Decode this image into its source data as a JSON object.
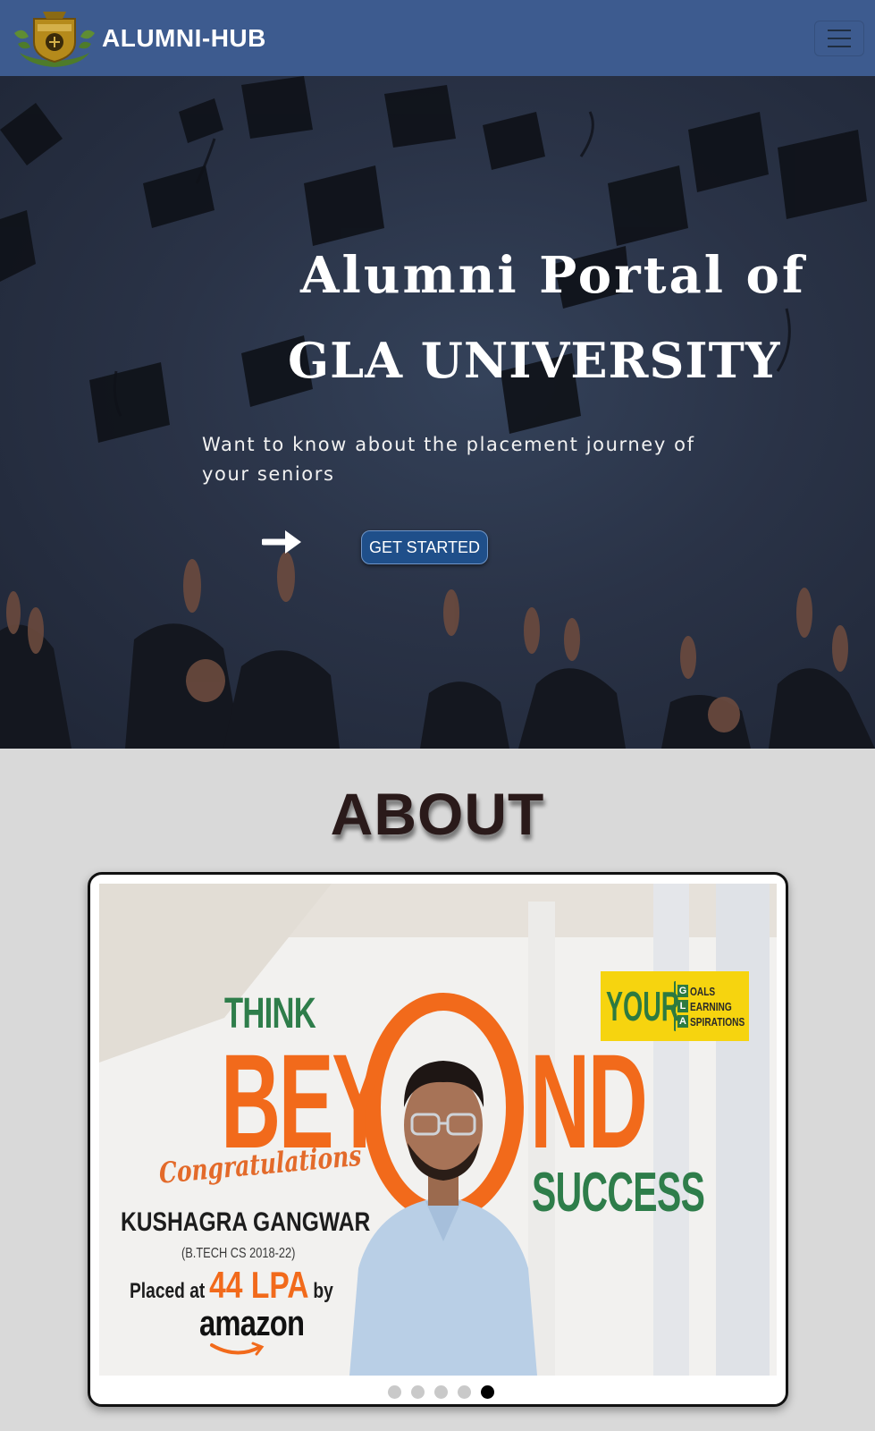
{
  "navbar": {
    "brand": "ALUMNI-HUB",
    "logo_icon": "gla-university-crest-icon",
    "menu_icon": "hamburger-menu-icon",
    "bg_color": "#3d5b8f"
  },
  "hero": {
    "title_line1": "Alumni Portal of",
    "title_line2": "GLA UNIVERSITY",
    "subtitle": "Want to know about the placement journey of your seniors",
    "arrow_icon": "arrow-right-icon",
    "cta_label": "GET STARTED",
    "cta_color": "#1f4f8a"
  },
  "about": {
    "heading": "ABOUT",
    "carousel": {
      "active_index": 4,
      "slide_count": 5,
      "slide": {
        "think": "THINK",
        "beyond_left": "BEY",
        "beyond_right": "ND",
        "success": "SUCCESS",
        "congrats": "Congratulations",
        "name": "KUSHAGRA GANGWAR",
        "batch": "(B.TECH CS 2018-22)",
        "placed_prefix": "Placed at",
        "package": "44 LPA",
        "placed_suffix": "by",
        "company": "amazon",
        "badge": {
          "your": "YOUR",
          "rows": [
            {
              "letter": "G",
              "word": "OALS"
            },
            {
              "letter": "L",
              "word": "EARNING"
            },
            {
              "letter": "A",
              "word": "SPIRATIONS"
            }
          ]
        },
        "accent_orange": "#f26a1b",
        "accent_green": "#2e7d4a",
        "badge_yellow": "#f6d40f"
      }
    }
  }
}
